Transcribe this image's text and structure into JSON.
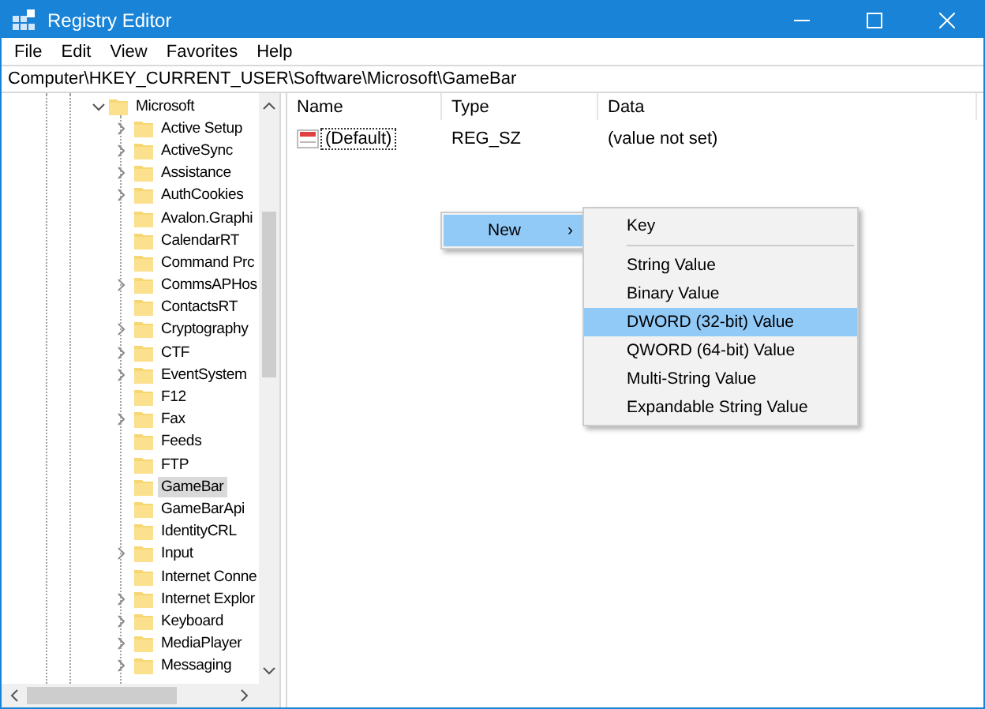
{
  "window": {
    "title": "Registry Editor"
  },
  "menu_bar": [
    "File",
    "Edit",
    "View",
    "Favorites",
    "Help"
  ],
  "address": "Computer\\HKEY_CURRENT_USER\\Software\\Microsoft\\GameBar",
  "tree": [
    {
      "label": "Microsoft",
      "expanded": true,
      "selected": false,
      "children": [
        {
          "label": "Active Setup",
          "has_children": true,
          "selected": false
        },
        {
          "label": "ActiveSync",
          "has_children": true,
          "selected": false
        },
        {
          "label": "Assistance",
          "has_children": true,
          "selected": false
        },
        {
          "label": "AuthCookies",
          "has_children": true,
          "selected": false
        },
        {
          "label": "Avalon.Graphi",
          "has_children": false,
          "selected": false
        },
        {
          "label": "CalendarRT",
          "has_children": false,
          "selected": false
        },
        {
          "label": "Command Prc",
          "has_children": false,
          "selected": false
        },
        {
          "label": "CommsAPHos",
          "has_children": true,
          "selected": false
        },
        {
          "label": "ContactsRT",
          "has_children": false,
          "selected": false
        },
        {
          "label": "Cryptography",
          "has_children": true,
          "selected": false
        },
        {
          "label": "CTF",
          "has_children": true,
          "selected": false
        },
        {
          "label": "EventSystem",
          "has_children": true,
          "selected": false
        },
        {
          "label": "F12",
          "has_children": false,
          "selected": false
        },
        {
          "label": "Fax",
          "has_children": true,
          "selected": false
        },
        {
          "label": "Feeds",
          "has_children": false,
          "selected": false
        },
        {
          "label": "FTP",
          "has_children": false,
          "selected": false
        },
        {
          "label": "GameBar",
          "has_children": false,
          "selected": true
        },
        {
          "label": "GameBarApi",
          "has_children": false,
          "selected": false
        },
        {
          "label": "IdentityCRL",
          "has_children": false,
          "selected": false
        },
        {
          "label": "Input",
          "has_children": true,
          "selected": false
        },
        {
          "label": "Internet Conne",
          "has_children": false,
          "selected": false
        },
        {
          "label": "Internet Explor",
          "has_children": true,
          "selected": false
        },
        {
          "label": "Keyboard",
          "has_children": true,
          "selected": false
        },
        {
          "label": "MediaPlayer",
          "has_children": true,
          "selected": false
        },
        {
          "label": "Messaging",
          "has_children": true,
          "selected": false
        }
      ]
    }
  ],
  "table": {
    "columns": [
      "Name",
      "Type",
      "Data"
    ],
    "rows": [
      {
        "name": "(Default)",
        "type": "REG_SZ",
        "data": "(value not set)",
        "focused": true
      }
    ]
  },
  "context_menu": {
    "items": [
      {
        "label": "New",
        "arrow": "›",
        "selected": true
      }
    ]
  },
  "submenu": {
    "items": [
      {
        "kind": "item",
        "label": "Key",
        "selected": false
      },
      {
        "kind": "separator"
      },
      {
        "kind": "item",
        "label": "String Value",
        "selected": false
      },
      {
        "kind": "item",
        "label": "Binary Value",
        "selected": false
      },
      {
        "kind": "item",
        "label": "DWORD (32-bit) Value",
        "selected": true
      },
      {
        "kind": "item",
        "label": "QWORD (64-bit) Value",
        "selected": false
      },
      {
        "kind": "item",
        "label": "Multi-String Value",
        "selected": false
      },
      {
        "kind": "item",
        "label": "Expandable String Value",
        "selected": false
      }
    ]
  }
}
